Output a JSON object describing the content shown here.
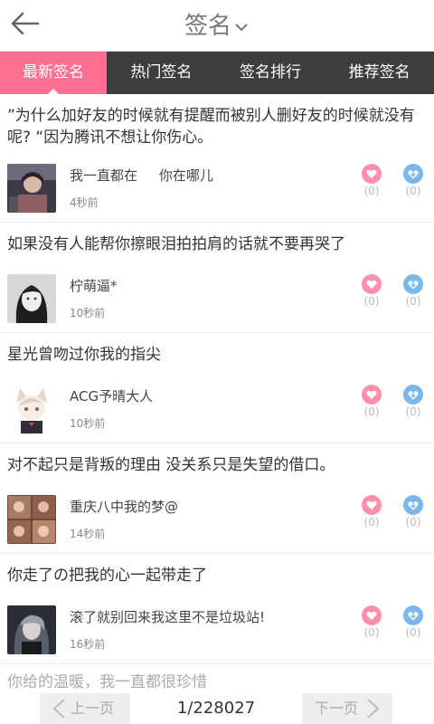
{
  "header": {
    "title": "签名"
  },
  "tabs": [
    {
      "label": "最新签名",
      "active": true
    },
    {
      "label": "热门签名",
      "active": false
    },
    {
      "label": "签名排行",
      "active": false
    },
    {
      "label": "推荐签名",
      "active": false
    }
  ],
  "posts": [
    {
      "text": "”为什么加好友的时候就有提醒而被别人删好友的时候就没有呢? “因为腾讯不想让你伤心。",
      "nickname": "我一直都在     你在哪儿",
      "time": "4秒前",
      "likes": "(0)",
      "shares": "(0)"
    },
    {
      "text": "如果没有人能帮你擦眼泪拍拍肩的话就不要再哭了",
      "nickname": "柠萌逼*",
      "time": "10秒前",
      "likes": "(0)",
      "shares": "(0)"
    },
    {
      "text": "星光曾吻过你我的指尖",
      "nickname": "ACG予晴大人",
      "time": "10秒前",
      "likes": "(0)",
      "shares": "(0)"
    },
    {
      "text": "对不起只是背叛的理由 没关系只是失望的借口。",
      "nickname": "重庆八中我的梦@",
      "time": "14秒前",
      "likes": "(0)",
      "shares": "(0)"
    },
    {
      "text": "你走了の把我的心一起带走了",
      "nickname": "滚了就别回来我这里不是垃圾站!",
      "time": "16秒前",
      "likes": "(0)",
      "shares": "(0)"
    }
  ],
  "partial_post": {
    "text": "你给的温暖，我一直都很珍惜"
  },
  "pager": {
    "prev_label": "上一页",
    "page": "1/228027",
    "next_label": "下一页"
  },
  "colors": {
    "accent": "#ff6f92",
    "tab_bar": "#3d3d3d",
    "like": "#ff8fab",
    "share": "#7ab8ec"
  },
  "icons": {
    "back": "arrow-left-icon",
    "title_dropdown": "chevron-down-icon",
    "like": "heart-icon",
    "share": "heart-arrow-icon",
    "prev": "chevron-left-icon",
    "next": "chevron-right-icon"
  }
}
